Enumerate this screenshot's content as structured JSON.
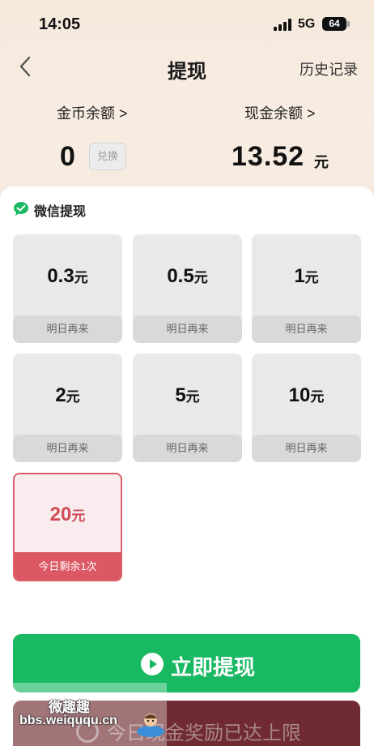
{
  "status_bar": {
    "time": "14:05",
    "network": "5G",
    "battery": "64"
  },
  "nav": {
    "title": "提现",
    "history": "历史记录"
  },
  "balances": {
    "coin_label": "金币余额 >",
    "coin_value": "0",
    "exchange_label": "兑换",
    "cash_label": "现金余额 >",
    "cash_value": "13.52",
    "cash_unit": "元"
  },
  "wechat": {
    "title": "微信提现"
  },
  "amounts": [
    {
      "value": "0.3",
      "unit": "元",
      "status": "明日再来"
    },
    {
      "value": "0.5",
      "unit": "元",
      "status": "明日再来"
    },
    {
      "value": "1",
      "unit": "元",
      "status": "明日再来"
    },
    {
      "value": "2",
      "unit": "元",
      "status": "明日再来"
    },
    {
      "value": "5",
      "unit": "元",
      "status": "明日再来"
    },
    {
      "value": "10",
      "unit": "元",
      "status": "明日再来"
    },
    {
      "value": "20",
      "unit": "元",
      "status": "今日剩余1次"
    }
  ],
  "withdraw_button": {
    "label": "立即提现"
  },
  "limit_notice": {
    "text": "今日现金奖励已达上限"
  },
  "watermark": {
    "title": "微趣趣",
    "url": "bbs.weiququ.cn"
  },
  "colors": {
    "accent_green": "#19b863",
    "active_red": "#dc5864",
    "limit_bar": "#6f2b31"
  }
}
